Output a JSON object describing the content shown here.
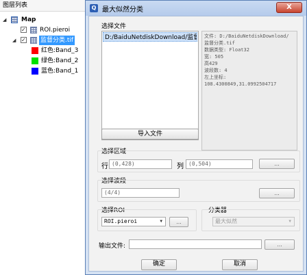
{
  "layer_panel": {
    "title": "图层列表",
    "root": "Map",
    "layers": [
      {
        "label": "ROI.pieroi",
        "checked": true,
        "icon": "grid-layer-icon"
      },
      {
        "label": "监督分类.tif",
        "checked": true,
        "icon": "grid-layer-icon",
        "selected": true
      }
    ],
    "bands": [
      {
        "label": "红色:Band_3",
        "color": "#ff0000"
      },
      {
        "label": "绿色:Band_2",
        "color": "#00e000"
      },
      {
        "label": "蓝色:Band_1",
        "color": "#0000ff"
      }
    ]
  },
  "dialog": {
    "title": "最大似然分类",
    "close_label": "X",
    "select_file_label": "选择文件",
    "file_list": [
      "D:/BaiduNetdiskDownload/监督分类.tif"
    ],
    "file_info": [
      "文件: D:/BaiduNetdiskDownload/",
      "监督分类.tif",
      "数据类型: Float32",
      "宽: 505",
      "高429",
      "波段数: 4",
      "左上坐标:",
      "108.4300849,31.0992504717"
    ],
    "import_button": "导入文件",
    "region": {
      "label": "选择区域",
      "row_label": "行",
      "row_value": "(0,428)",
      "col_label": "列",
      "col_value": "(0,504)",
      "browse": "..."
    },
    "band": {
      "label": "选择波段",
      "value": "(4/4)",
      "browse": "..."
    },
    "roi": {
      "label": "选择ROI",
      "value": "ROI.pieroi",
      "browse": "..."
    },
    "classifier": {
      "label": "分类器",
      "value": "最大似然"
    },
    "output": {
      "label": "输出文件:",
      "value": "",
      "browse": "..."
    },
    "ok_button": "确定",
    "cancel_button": "取消"
  },
  "colors": {
    "title_bar": "#b5cbeb",
    "selection": "#cce0f8",
    "close_button": "#c8442f"
  }
}
